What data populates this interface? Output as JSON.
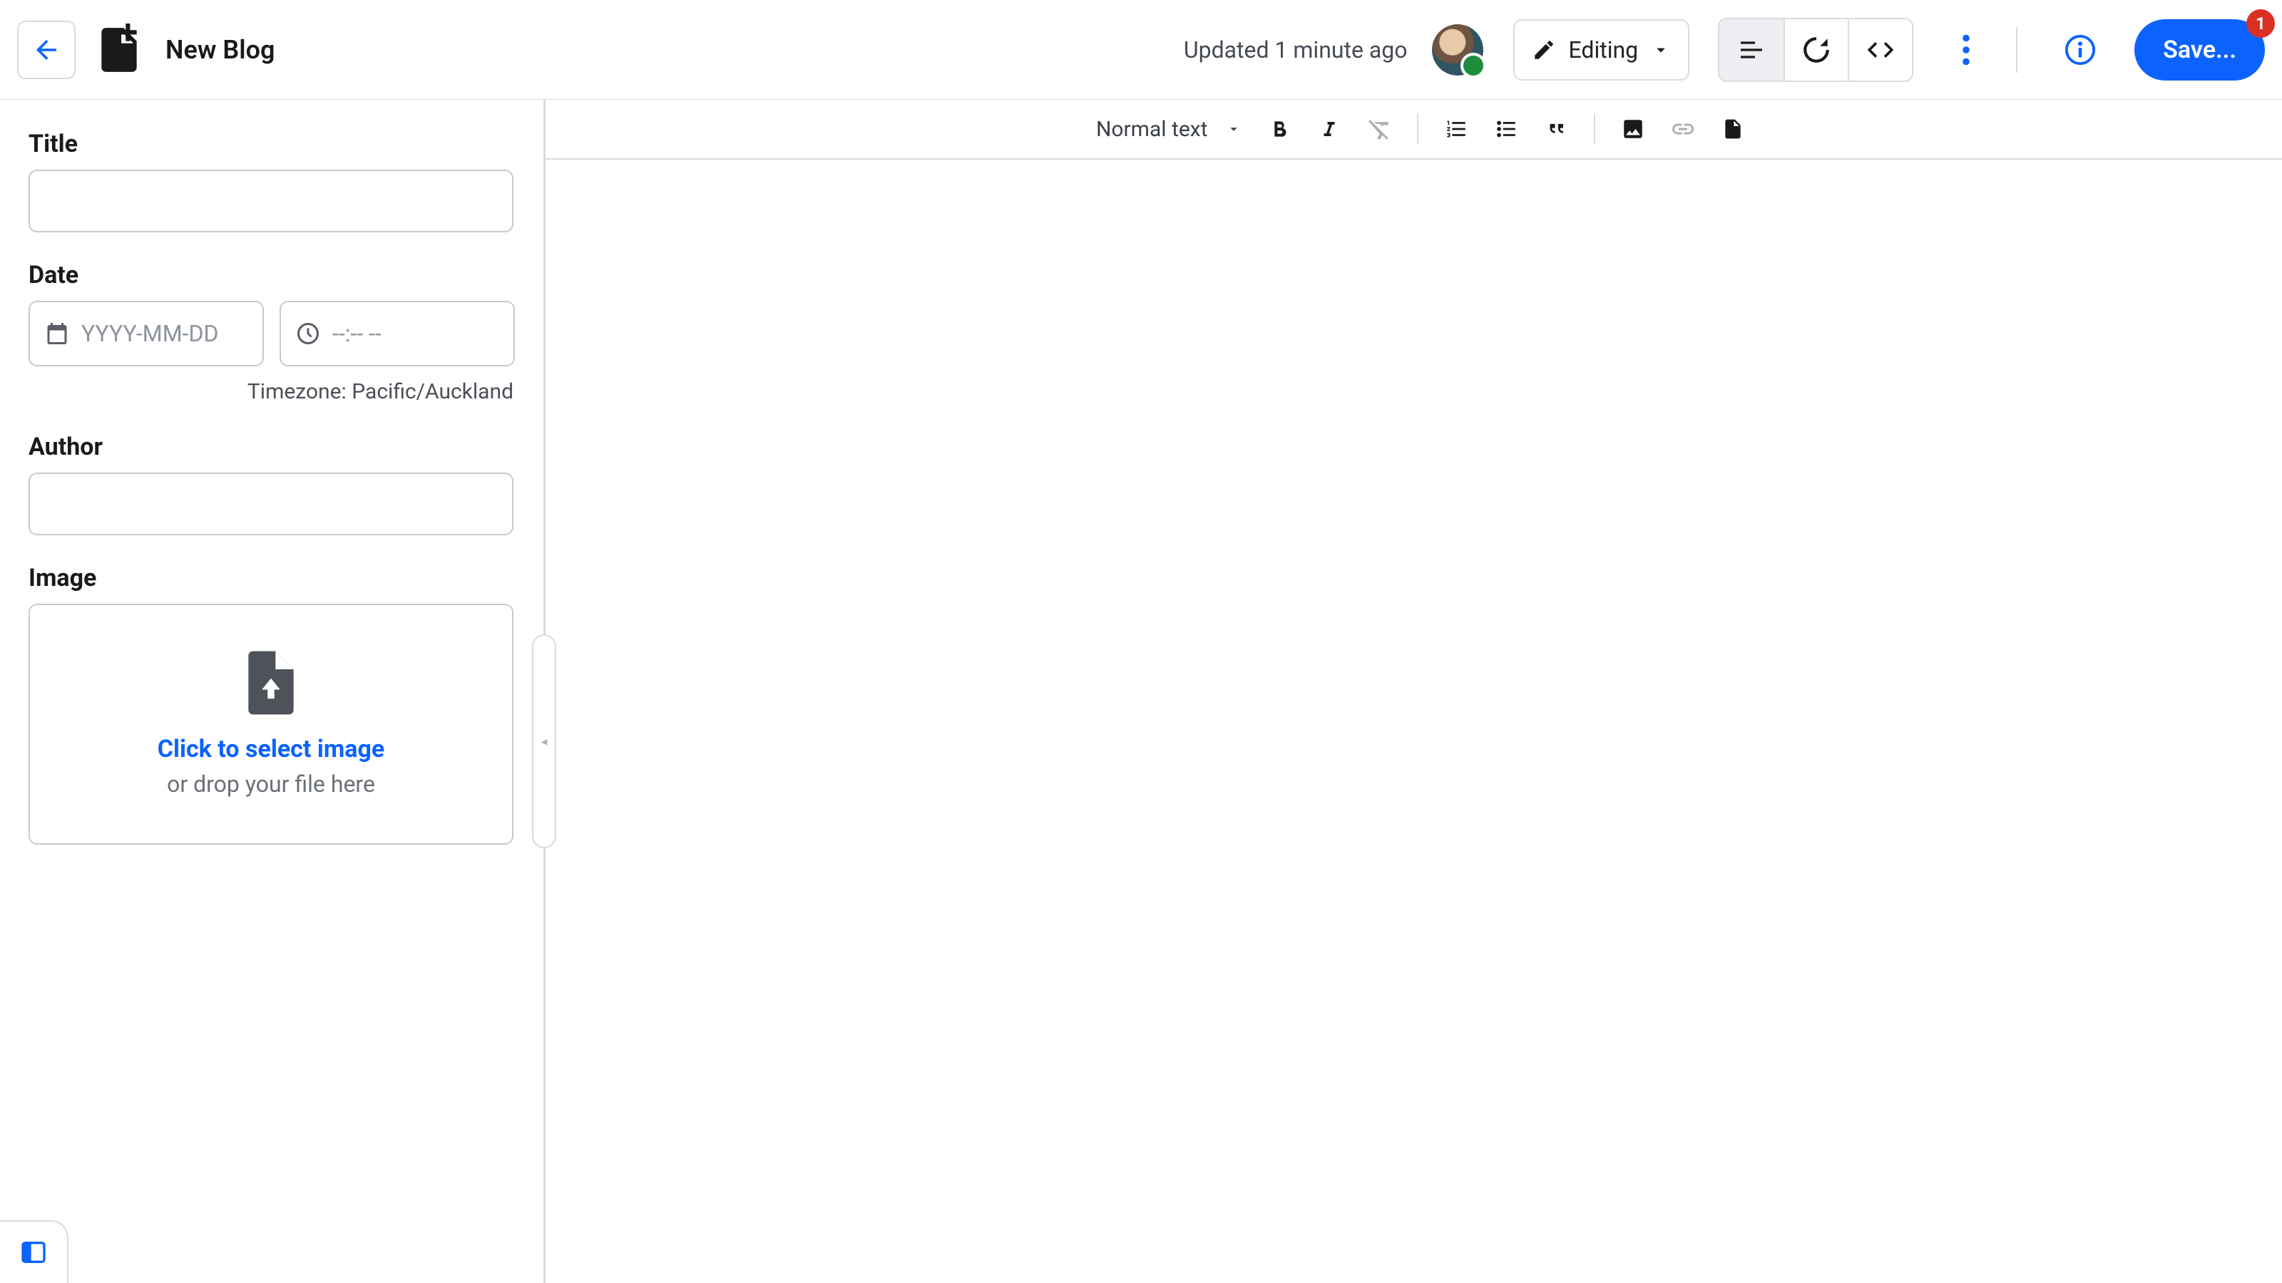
{
  "header": {
    "page_title": "New Blog",
    "updated_text": "Updated 1 minute ago",
    "mode_label": "Editing",
    "save_label": "Save...",
    "save_badge": "1"
  },
  "sidebar": {
    "title": {
      "label": "Title",
      "value": ""
    },
    "date": {
      "label": "Date",
      "date_placeholder": "YYYY-MM-DD",
      "time_placeholder": "--:-- --"
    },
    "timezone_text": "Timezone: Pacific/Auckland",
    "author": {
      "label": "Author",
      "value": ""
    },
    "image": {
      "label": "Image",
      "click_text": "Click to select image",
      "drop_text": "or drop your file here"
    }
  },
  "toolbar": {
    "text_style": "Normal text"
  },
  "icons": {
    "back": "arrow-left",
    "doc": "new-document",
    "pencil": "pencil",
    "chevron": "chevron-down",
    "view_content": "content-view",
    "view_data": "data-sync",
    "view_code": "code",
    "more": "more-vertical",
    "info": "info",
    "calendar": "calendar",
    "clock": "clock",
    "upload_file": "file-upload",
    "panel": "panel"
  }
}
